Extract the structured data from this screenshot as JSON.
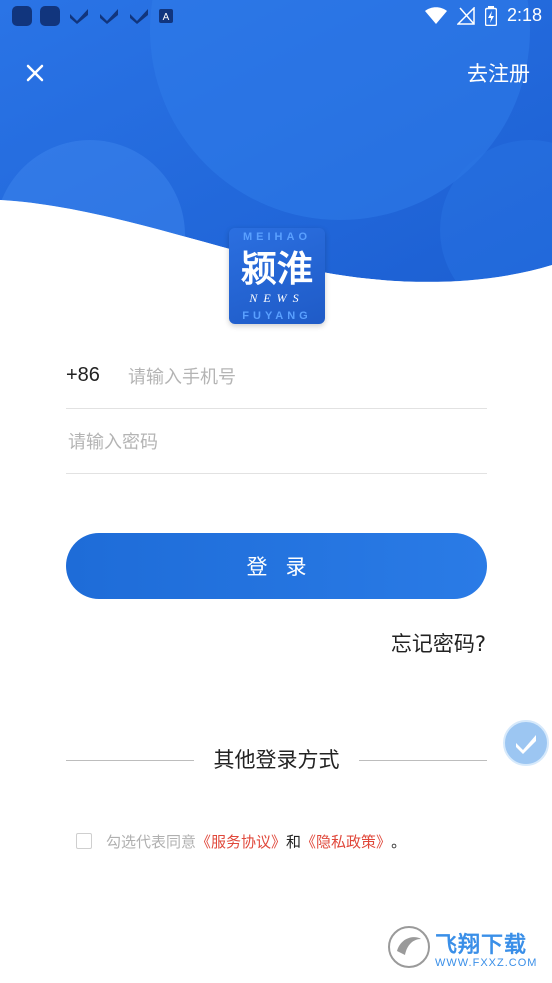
{
  "status_bar": {
    "time": "2:18"
  },
  "header": {
    "register_label": "去注册"
  },
  "logo": {
    "top_text": "MEIHAO",
    "main_text": "颍淮",
    "news_text": "NEWS",
    "bottom_text": "FUYANG"
  },
  "form": {
    "country_code": "+86",
    "phone_placeholder": "请输入手机号",
    "phone_value": "",
    "password_placeholder": "请输入密码",
    "password_value": "",
    "login_label": "登录",
    "forgot_label": "忘记密码?"
  },
  "other_login": {
    "label": "其他登录方式"
  },
  "agreement": {
    "checked": false,
    "prefix": "勾选代表同意",
    "service_label": "《服务协议》",
    "and_label": "和",
    "privacy_label": "《隐私政策》",
    "suffix": "。"
  },
  "watermark": {
    "brand": "飞翔下载",
    "url": "WWW.FXXZ.COM"
  },
  "colors": {
    "primary": "#1e6cd8",
    "link_red": "#e0483b",
    "placeholder": "#b4b4b4"
  }
}
